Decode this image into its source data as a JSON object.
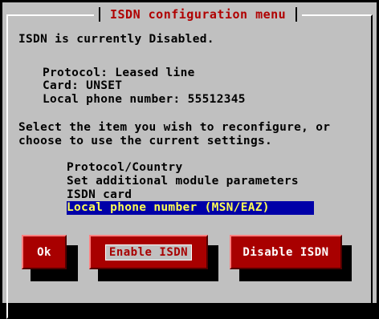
{
  "dialog": {
    "title": "ISDN configuration menu",
    "status_line": "ISDN is currently Disabled.",
    "protocol_line": "Protocol: Leased line",
    "card_line": "Card: UNSET",
    "phone_line": "Local phone number: 55512345",
    "instructions_1": "Select the item you wish to reconfigure, or",
    "instructions_2": "choose to use the current settings."
  },
  "menu": {
    "items": [
      {
        "label": "Protocol/Country",
        "selected": false
      },
      {
        "label": "Set additional module parameters",
        "selected": false
      },
      {
        "label": "ISDN card",
        "selected": false
      },
      {
        "label": "Local phone number (MSN/EAZ)",
        "selected": true
      }
    ]
  },
  "buttons": {
    "ok": "Ok",
    "enable": "Enable ISDN",
    "disable": "Disable ISDN"
  },
  "colors": {
    "background": "#c0c0c0",
    "title": "#b00000",
    "selection_bg": "#0000a8",
    "selection_fg": "#ffff55",
    "button": "#a80000"
  }
}
